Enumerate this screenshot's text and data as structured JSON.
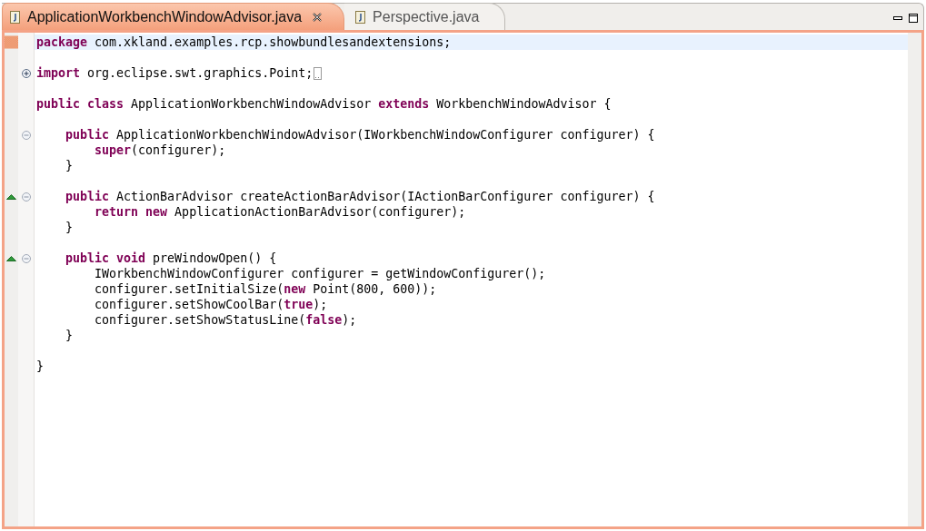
{
  "tabs": [
    {
      "label": "ApplicationWorkbenchWindowAdvisor.java",
      "selected": true,
      "closable": true
    },
    {
      "label": "Perspective.java",
      "selected": false,
      "closable": false
    }
  ],
  "editor": {
    "blocks": [
      {
        "lines": [
          {
            "marked": true,
            "current": true,
            "tokens": [
              {
                "kind": "keyword",
                "text": "package"
              },
              {
                "kind": "plain",
                "text": " com.xkland.examples.rcp.showbundlesandextensions;"
              }
            ]
          }
        ]
      },
      {
        "lines": [
          {
            "collapsed": true,
            "current": false,
            "tokens": [
              {
                "kind": "keyword",
                "text": "import"
              },
              {
                "kind": "plain",
                "text": " org.eclipse.swt.graphics.Point;"
              }
            ]
          }
        ]
      },
      {
        "lines": [
          {
            "current": false,
            "tokens": [
              {
                "kind": "keyword",
                "text": "public class"
              },
              {
                "kind": "plain",
                "text": " ApplicationWorkbenchWindowAdvisor "
              },
              {
                "kind": "keyword",
                "text": "extends"
              },
              {
                "kind": "plain",
                "text": " WorkbenchWindowAdvisor {"
              }
            ]
          }
        ]
      },
      {
        "lines": [
          {
            "collapsed": false,
            "current": false,
            "tokens": [
              {
                "kind": "keyword",
                "text": "    public"
              },
              {
                "kind": "plain",
                "text": " ApplicationWorkbenchWindowAdvisor(IWorkbenchWindowConfigurer configurer) {"
              }
            ]
          },
          {
            "current": false,
            "tokens": [
              {
                "kind": "keyword",
                "text": "        super"
              },
              {
                "kind": "plain",
                "text": "(configurer);"
              }
            ]
          },
          {
            "current": false,
            "tokens": [
              {
                "kind": "plain",
                "text": "    }"
              }
            ]
          }
        ]
      },
      {
        "lines": [
          {
            "override": true,
            "collapsed": false,
            "current": false,
            "tokens": [
              {
                "kind": "keyword",
                "text": "    public"
              },
              {
                "kind": "plain",
                "text": " ActionBarAdvisor createActionBarAdvisor(IActionBarConfigurer configurer) {"
              }
            ]
          },
          {
            "current": false,
            "tokens": [
              {
                "kind": "keyword",
                "text": "        return new"
              },
              {
                "kind": "plain",
                "text": " ApplicationActionBarAdvisor(configurer);"
              }
            ]
          },
          {
            "current": false,
            "tokens": [
              {
                "kind": "plain",
                "text": "    }"
              }
            ]
          }
        ]
      },
      {
        "lines": [
          {
            "override": true,
            "collapsed": false,
            "current": false,
            "tokens": [
              {
                "kind": "keyword",
                "text": "    public void"
              },
              {
                "kind": "plain",
                "text": " preWindowOpen() {"
              }
            ]
          },
          {
            "current": false,
            "tokens": [
              {
                "kind": "plain",
                "text": "        IWorkbenchWindowConfigurer configurer = getWindowConfigurer();"
              }
            ]
          },
          {
            "current": false,
            "tokens": [
              {
                "kind": "plain",
                "text": "        configurer.setInitialSize("
              },
              {
                "kind": "keyword",
                "text": "new"
              },
              {
                "kind": "plain",
                "text": " Point(800, 600));"
              }
            ]
          },
          {
            "current": false,
            "tokens": [
              {
                "kind": "plain",
                "text": "        configurer.setShowCoolBar("
              },
              {
                "kind": "keyword",
                "text": "true"
              },
              {
                "kind": "plain",
                "text": ");"
              }
            ]
          },
          {
            "current": false,
            "tokens": [
              {
                "kind": "plain",
                "text": "        configurer.setShowStatusLine("
              },
              {
                "kind": "keyword",
                "text": "false"
              },
              {
                "kind": "plain",
                "text": ");"
              }
            ]
          },
          {
            "current": false,
            "tokens": [
              {
                "kind": "plain",
                "text": "    }"
              }
            ]
          }
        ]
      },
      {
        "lines": [
          {
            "current": false,
            "tokens": [
              {
                "kind": "plain",
                "text": "}"
              }
            ]
          }
        ]
      }
    ]
  }
}
